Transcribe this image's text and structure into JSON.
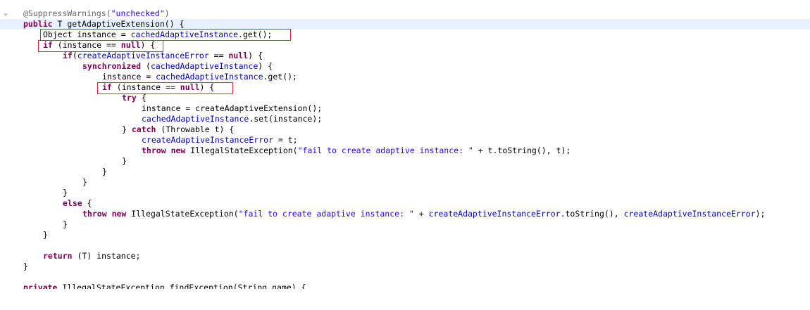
{
  "editor": {
    "lines": [
      {
        "indent": 0,
        "highlight": false,
        "tokens": [
          [
            "ann",
            "@SuppressWarnings("
          ],
          [
            "str",
            "\"unchecked\""
          ],
          [
            "ann",
            ")"
          ]
        ]
      },
      {
        "indent": 0,
        "highlight": true,
        "tokens": [
          [
            "kw",
            "public"
          ],
          [
            "plain",
            " T getAdaptiveExtension() {"
          ]
        ]
      },
      {
        "indent": 1,
        "highlight": false,
        "tokens": [
          [
            "plain",
            "Object instance = "
          ],
          [
            "fld",
            "cachedAdaptiveInstance"
          ],
          [
            "plain",
            ".get();"
          ]
        ]
      },
      {
        "indent": 1,
        "highlight": false,
        "tokens": [
          [
            "kw",
            "if"
          ],
          [
            "plain",
            " (instance == "
          ],
          [
            "kw",
            "null"
          ],
          [
            "plain",
            ") {"
          ]
        ]
      },
      {
        "indent": 2,
        "highlight": false,
        "tokens": [
          [
            "kw",
            "if"
          ],
          [
            "plain",
            "("
          ],
          [
            "fld",
            "createAdaptiveInstanceError"
          ],
          [
            "plain",
            " == "
          ],
          [
            "kw",
            "null"
          ],
          [
            "plain",
            ") {"
          ]
        ]
      },
      {
        "indent": 3,
        "highlight": false,
        "tokens": [
          [
            "kw",
            "synchronized"
          ],
          [
            "plain",
            " ("
          ],
          [
            "fld",
            "cachedAdaptiveInstance"
          ],
          [
            "plain",
            ") {"
          ]
        ]
      },
      {
        "indent": 4,
        "highlight": false,
        "tokens": [
          [
            "plain",
            "instance = "
          ],
          [
            "fld",
            "cachedAdaptiveInstance"
          ],
          [
            "plain",
            ".get();"
          ]
        ]
      },
      {
        "indent": 4,
        "highlight": false,
        "tokens": [
          [
            "kw",
            "if"
          ],
          [
            "plain",
            " (instance == "
          ],
          [
            "kw",
            "null"
          ],
          [
            "plain",
            ") {"
          ]
        ]
      },
      {
        "indent": 5,
        "highlight": false,
        "tokens": [
          [
            "kw",
            "try"
          ],
          [
            "plain",
            " {"
          ]
        ]
      },
      {
        "indent": 6,
        "highlight": false,
        "tokens": [
          [
            "plain",
            "instance = createAdaptiveExtension();"
          ]
        ]
      },
      {
        "indent": 6,
        "highlight": false,
        "tokens": [
          [
            "fld",
            "cachedAdaptiveInstance"
          ],
          [
            "plain",
            ".set(instance);"
          ]
        ]
      },
      {
        "indent": 5,
        "highlight": false,
        "tokens": [
          [
            "plain",
            "} "
          ],
          [
            "kw",
            "catch"
          ],
          [
            "plain",
            " (Throwable t) {"
          ]
        ]
      },
      {
        "indent": 6,
        "highlight": false,
        "tokens": [
          [
            "fld",
            "createAdaptiveInstanceError"
          ],
          [
            "plain",
            " = t;"
          ]
        ]
      },
      {
        "indent": 6,
        "highlight": false,
        "tokens": [
          [
            "kw",
            "throw"
          ],
          [
            "plain",
            " "
          ],
          [
            "kw",
            "new"
          ],
          [
            "plain",
            " IllegalStateException("
          ],
          [
            "str",
            "\"fail to create adaptive instance: \""
          ],
          [
            "plain",
            " + t.toString(), t);"
          ]
        ]
      },
      {
        "indent": 5,
        "highlight": false,
        "tokens": [
          [
            "plain",
            "}"
          ]
        ]
      },
      {
        "indent": 4,
        "highlight": false,
        "tokens": [
          [
            "plain",
            "}"
          ]
        ]
      },
      {
        "indent": 3,
        "highlight": false,
        "tokens": [
          [
            "plain",
            "}"
          ]
        ]
      },
      {
        "indent": 2,
        "highlight": false,
        "tokens": [
          [
            "plain",
            "}"
          ]
        ]
      },
      {
        "indent": 2,
        "highlight": false,
        "tokens": [
          [
            "kw",
            "else"
          ],
          [
            "plain",
            " {"
          ]
        ]
      },
      {
        "indent": 3,
        "highlight": false,
        "tokens": [
          [
            "kw",
            "throw"
          ],
          [
            "plain",
            " "
          ],
          [
            "kw",
            "new"
          ],
          [
            "plain",
            " IllegalStateException("
          ],
          [
            "str",
            "\"fail to create adaptive instance: \""
          ],
          [
            "plain",
            " + "
          ],
          [
            "fld",
            "createAdaptiveInstanceError"
          ],
          [
            "plain",
            ".toString(), "
          ],
          [
            "fld",
            "createAdaptiveInstanceError"
          ],
          [
            "plain",
            ");"
          ]
        ]
      },
      {
        "indent": 2,
        "highlight": false,
        "tokens": [
          [
            "plain",
            "}"
          ]
        ]
      },
      {
        "indent": 1,
        "highlight": false,
        "tokens": [
          [
            "plain",
            "}"
          ]
        ]
      },
      {
        "indent": 0,
        "highlight": false,
        "tokens": []
      },
      {
        "indent": 1,
        "highlight": false,
        "tokens": [
          [
            "kw",
            "return"
          ],
          [
            "plain",
            " (T) instance;"
          ]
        ]
      },
      {
        "indent": 0,
        "highlight": false,
        "tokens": [
          [
            "plain",
            "}"
          ]
        ]
      },
      {
        "indent": 0,
        "highlight": false,
        "tokens": []
      }
    ],
    "cut_line": {
      "indent": 0,
      "tokens": [
        [
          "kw",
          "private"
        ],
        [
          "plain",
          " IllegalStateException findException(String name) {"
        ]
      ]
    }
  },
  "gutter": {
    "fold_icon": "collapse-fold-icon"
  },
  "colors": {
    "keyword": "#7f0055",
    "string": "#2a00ff",
    "field": "#0000c0",
    "annotation": "#646464",
    "current_line": "#e8f2fe",
    "annotation_box": "#e0262c"
  }
}
